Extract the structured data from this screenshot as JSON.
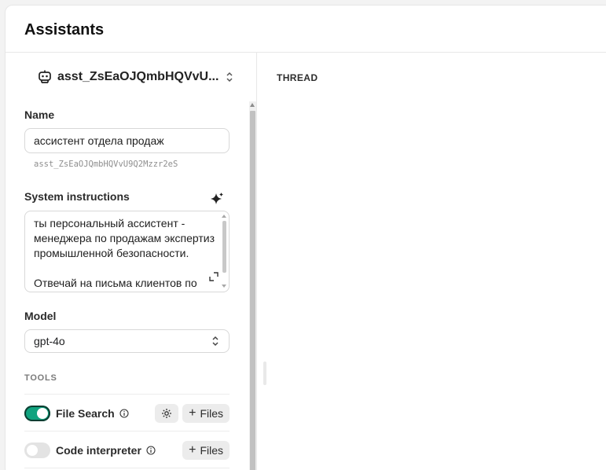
{
  "header": {
    "title": "Assistants"
  },
  "assistant": {
    "selector_label": "asst_ZsEaOJQmbHQVvU...",
    "id": "asst_ZsEaOJQmbHQVvU9Q2Mzzr2eS"
  },
  "form": {
    "name_label": "Name",
    "name_value": "ассистент отдела продаж",
    "instructions_label": "System instructions",
    "instructions_value": "ты персональный ассистент - менеджера по продажам экспертиз промышленной безопасности.\n\nОтвечай на письма клиентов по",
    "model_label": "Model",
    "model_value": "gpt-4o"
  },
  "tools": {
    "section_label": "TOOLS",
    "items": [
      {
        "name": "File Search",
        "enabled": true,
        "files_label": "Files"
      },
      {
        "name": "Code interpreter",
        "enabled": false,
        "files_label": "Files"
      }
    ]
  },
  "thread": {
    "label": "THREAD"
  },
  "colors": {
    "toggle_on": "#10a37f",
    "toggle_off": "#e3e3e3"
  }
}
